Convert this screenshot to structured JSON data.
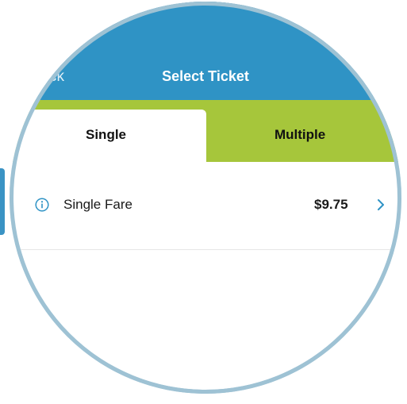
{
  "header": {
    "back_label": "ck",
    "title": "Select Ticket"
  },
  "tabs": [
    {
      "label": "Single",
      "selected": true
    },
    {
      "label": "Multiple",
      "selected": false
    }
  ],
  "fares": [
    {
      "label": "Single Fare",
      "price": "$9.75",
      "icon": "info-icon"
    }
  ],
  "colors": {
    "header_bg": "#2f93c5",
    "tab_bar_bg": "#a6c63b",
    "accent_blue": "#2f93c5",
    "lens_border": "#9ec2d4"
  }
}
